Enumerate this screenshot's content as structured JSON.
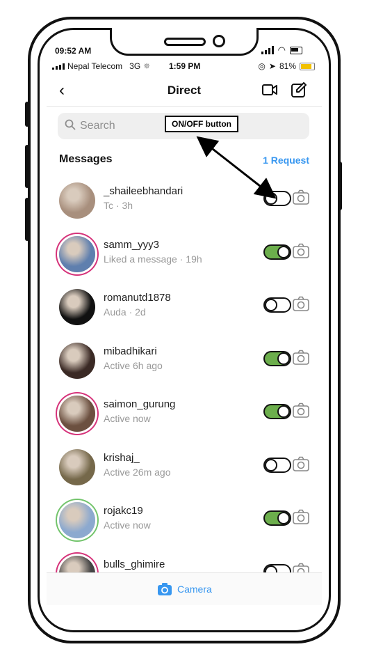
{
  "device": {
    "time": "09:52 AM"
  },
  "status_bar": {
    "carrier": "Nepal Telecom",
    "network": "3G",
    "time": "1:59 PM",
    "battery": "81%"
  },
  "nav": {
    "title": "Direct"
  },
  "search": {
    "placeholder": "Search"
  },
  "annotation": {
    "label": "ON/OFF button"
  },
  "messages_header": {
    "title": "Messages",
    "request": "1 Request"
  },
  "conversations": [
    {
      "username": "_shaileebhandari",
      "subtitle": "Tc · 3h",
      "toggle": "off",
      "ring": "none",
      "avatar_color": "#a88f7d"
    },
    {
      "username": "samm_yyy3",
      "subtitle": "Liked a message · 19h",
      "toggle": "on",
      "ring": "story",
      "avatar_color": "#5f7fae"
    },
    {
      "username": "romanutd1878",
      "subtitle": "Auda · 2d",
      "toggle": "off",
      "ring": "none",
      "avatar_color": "#111111"
    },
    {
      "username": "mibadhikari",
      "subtitle": "Active 6h ago",
      "toggle": "on",
      "ring": "none",
      "avatar_color": "#3b2a25"
    },
    {
      "username": "saimon_gurung",
      "subtitle": "Active now",
      "toggle": "on",
      "ring": "story",
      "avatar_color": "#6c5040"
    },
    {
      "username": "krishaj_",
      "subtitle": "Active 26m ago",
      "toggle": "off",
      "ring": "none",
      "avatar_color": "#75684a"
    },
    {
      "username": "rojakc19",
      "subtitle": "Active now",
      "toggle": "on",
      "ring": "green",
      "avatar_color": "#8ca9cf"
    },
    {
      "username": "bulls_ghimire",
      "subtitle": "",
      "toggle": "off",
      "ring": "story",
      "avatar_color": "#444444"
    }
  ],
  "bottom": {
    "camera_label": "Camera"
  },
  "colors": {
    "accent": "#3897f0",
    "toggle_on": "#6cae4c"
  }
}
